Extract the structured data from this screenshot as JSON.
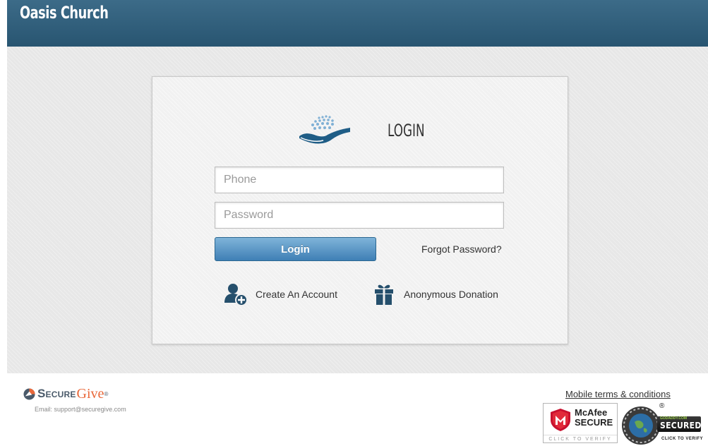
{
  "header": {
    "title": "Oasis Church"
  },
  "login": {
    "title": "LOGIN",
    "phone_placeholder": "Phone",
    "password_placeholder": "Password",
    "login_button": "Login",
    "forgot_link": "Forgot Password?",
    "create_account": "Create An Account",
    "anonymous_donation": "Anonymous Donation"
  },
  "footer": {
    "brand_secure": "Secure",
    "brand_give": "Give",
    "brand_reg": "®",
    "support_email": "Email: support@securegive.com",
    "terms_link": "Mobile terms & conditions",
    "mcafee": {
      "name": "McAfee",
      "secure": "SECURE",
      "verify": "CLICK TO VERIFY"
    },
    "godaddy": {
      "reg": "®",
      "small": "GODADDY.COM",
      "secured": "SECURED",
      "verify": "CLICK TO VERIFY"
    }
  },
  "icons": {
    "logo": "hand-with-dots-icon",
    "create_account": "add-user-icon",
    "anonymous_donation": "gift-icon",
    "brand_mark": "securegive-mark-icon"
  },
  "colors": {
    "header": "#285571",
    "button": "#3f7fb5",
    "brand_give": "#e9683a"
  }
}
